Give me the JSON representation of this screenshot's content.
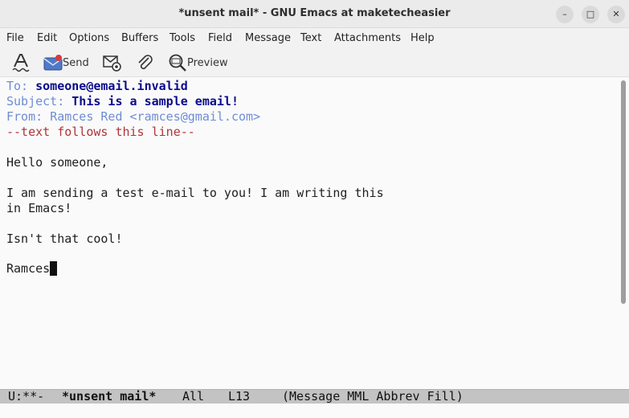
{
  "window": {
    "title": "*unsent mail* - GNU Emacs at maketecheasier",
    "minimize_label": "–",
    "maximize_label": "□",
    "close_label": "✕"
  },
  "menu": {
    "items": [
      "File",
      "Edit",
      "Options",
      "Buffers",
      "Tools",
      "Field",
      "Message",
      "Text",
      "Attachments",
      "Help"
    ]
  },
  "toolbar": {
    "send_label": "Send",
    "preview_label": "Preview"
  },
  "message": {
    "to_label": "To:",
    "to_value": "someone@email.invalid",
    "subject_label": "Subject:",
    "subject_value": "This is a sample email!",
    "from_label": "From:",
    "from_value": "Ramces Red <ramces@gmail.com>",
    "separator": "--text follows this line--",
    "body": [
      "Hello someone,",
      "I am sending a test e-mail to you! I am writing this",
      "in Emacs!",
      "Isn't that cool!",
      "Ramces"
    ]
  },
  "modeline": {
    "status": "U:**-",
    "buffer_name": "*unsent mail*",
    "position": "All",
    "line": "L13",
    "modes": "(Message MML Abbrev Fill)"
  },
  "colors": {
    "header_name": "#6f8dd4",
    "header_value": "#0b0b8c",
    "separator": "#b0343a",
    "modeline_bg": "#c3c3c3"
  }
}
